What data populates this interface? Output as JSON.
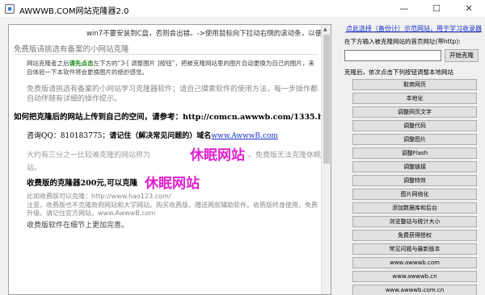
{
  "window": {
    "title": "AWWWB.COM网站克隆器2.0",
    "min_glyph": "—",
    "max_glyph": "☐",
    "close_glyph": "✕"
  },
  "web": {
    "hint": "win7不要安装到C盘，否则会出错。->使用鼠标向下拉动右侧的滚动条，以便查看更多的介绍-->",
    "page_head": "免费版请挑选有备案的小网站克隆",
    "intro_a": "网站克隆者之后",
    "intro_green": "请先点击",
    "intro_b": "左下方的“3-[ 调整图片 ]按钮”，把被克隆网站里的图片自动更换为自己的图片，来自体验一下本软件将会更换图片的绝妙感觉。",
    "p2": "免费版请挑选有备案的小网站学习克隆器软件；请自己摸索软件的使用方法，每一步操作都自动伴随有详细的操作提示。",
    "heading1": "如何把克隆后的网站上传到自己的空间，请参考：http://comcn.awwwb.com/1335.html",
    "qq_label": "咨询QQ：810183775；",
    "qq_bold": "请记住（解决常见问题的）域名",
    "qq_link": "www.AwwwB.com",
    "p3a": "大约有三分之一比较难克隆的网站称为",
    "big_text": "休眠网站",
    "p3b": "。免费版无法克隆休眠状态的网",
    "p3c": "站。",
    "line4": "收费版的克隆器200元,可以克隆",
    "big_text2": "休眠网站",
    "line4_end": "。",
    "p4a": "比如收费版可以克隆：http://www.hao123.com/",
    "p4b": "注意，收费版也不克隆政府网站和大学网站。购买收费版，赠送两款辅助软件。收费版终身使用，免费升级。请记住官方网站，www.AwwwB.com",
    "p5": "收费版软件在细节上更加完善。"
  },
  "right": {
    "top_link": "点此选择（备份计）示范网站，用于学习收录器",
    "url_label": "在下方输入被克隆网站的首页网址(带http):",
    "url_value": "",
    "start_button": "开始克隆",
    "step_label": "克隆后，依次点击下列按钮调整本地网站",
    "buttons": [
      "取商网页",
      "本地化",
      "调整网页文字",
      "调整代码",
      "调整图片",
      "调整Flash",
      "调整链接",
      "调整特效",
      "图片网络化",
      "添加数据库和后台",
      "浏览整站与统计大小",
      "免费获得授权",
      "常见问题与最新版本",
      "www.awwwb.com",
      "www.awwwb.cn",
      "www.awwwb.com.cn"
    ]
  }
}
